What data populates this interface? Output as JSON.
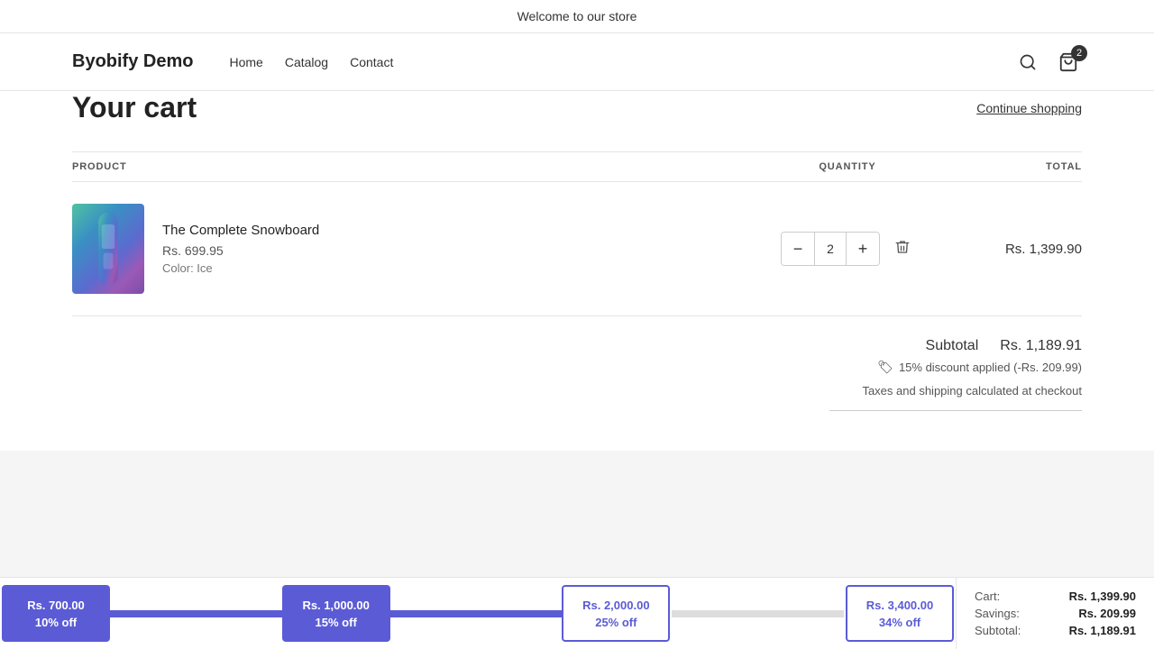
{
  "announcement": {
    "text": "Welcome to our store"
  },
  "header": {
    "logo": "Byobify Demo",
    "nav": [
      "Home",
      "Catalog",
      "Contact"
    ],
    "cart_count": "2"
  },
  "cart": {
    "title": "Your cart",
    "continue_shopping": "Continue shopping",
    "columns": {
      "product": "PRODUCT",
      "quantity": "QUANTITY",
      "total": "TOTAL"
    },
    "items": [
      {
        "name": "The Complete Snowboard",
        "price": "Rs. 699.95",
        "color": "Color: Ice",
        "quantity": 2,
        "total": "Rs. 1,399.90"
      }
    ],
    "subtotal_label": "Subtotal",
    "subtotal_value": "Rs. 1,189.91",
    "discount_text": "15% discount applied (-Rs. 209.99)",
    "taxes_note": "Taxes and shipping calculated at checkout"
  },
  "progress": {
    "tiers": [
      {
        "amount": "Rs. 700.00",
        "discount": "10% off",
        "filled": true
      },
      {
        "amount": "Rs. 1,000.00",
        "discount": "15% off",
        "filled": true
      },
      {
        "amount": "Rs. 2,000.00",
        "discount": "25% off",
        "filled": false
      },
      {
        "amount": "Rs. 3,400.00",
        "discount": "34% off",
        "filled": false
      }
    ],
    "summary": {
      "cart_label": "Cart:",
      "cart_value": "Rs. 1,399.90",
      "savings_label": "Savings:",
      "savings_value": "Rs. 209.99",
      "subtotal_label": "Subtotal:",
      "subtotal_value": "Rs. 1,189.91"
    }
  }
}
